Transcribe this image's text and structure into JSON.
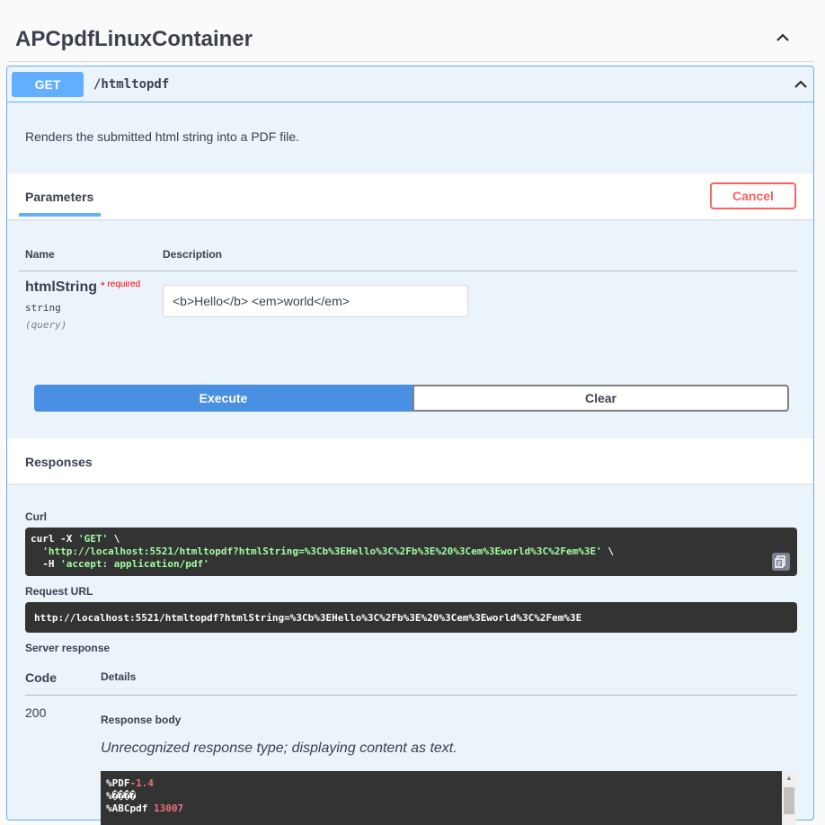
{
  "tag": {
    "title": "APCpdfLinuxContainer"
  },
  "operation": {
    "method": "GET",
    "path": "/htmltopdf",
    "description": "Renders the submitted html string into a PDF file."
  },
  "parameters": {
    "tab_label": "Parameters",
    "cancel_label": "Cancel",
    "col_name": "Name",
    "col_description": "Description",
    "items": [
      {
        "name": "htmlString",
        "required_star": "*",
        "required_label": "required",
        "type": "string",
        "in": "(query)",
        "value": "<b>Hello</b> <em>world</em>"
      }
    ]
  },
  "actions": {
    "execute_label": "Execute",
    "clear_label": "Clear"
  },
  "responses": {
    "title": "Responses",
    "curl_label": "Curl",
    "curl": {
      "line1_cmd": "curl -X ",
      "line1_method": "'GET'",
      "line1_tail": " \\",
      "line2_url": "  'http://localhost:5521/htmltopdf?htmlString=%3Cb%3EHello%3C%2Fb%3E%20%3Cem%3Eworld%3C%2Fem%3E'",
      "line2_tail": " \\",
      "line3_cmd": "  -H ",
      "line3_header": "'accept: application/pdf'"
    },
    "request_url_label": "Request URL",
    "request_url": "http://localhost:5521/htmltopdf?htmlString=%3Cb%3EHello%3C%2Fb%3E%20%3Cem%3Eworld%3C%2Fem%3E",
    "server_response_label": "Server response",
    "col_code": "Code",
    "col_details": "Details",
    "status_code": "200",
    "response_body_label": "Response body",
    "response_note": "Unrecognized response type; displaying content as text.",
    "body_lines": [
      {
        "text": "%PDF",
        "accent": "-1.4"
      },
      {
        "text": "%����",
        "accent": ""
      },
      {
        "text": "%ABCpdf ",
        "accent": "13007"
      }
    ]
  },
  "colors": {
    "get_accent": "#61affe",
    "execute": "#4990e2",
    "cancel": "#ff6060",
    "code_bg": "#333333"
  },
  "icons": {
    "collapse": "chevron-up-icon",
    "copy": "copy-icon"
  }
}
